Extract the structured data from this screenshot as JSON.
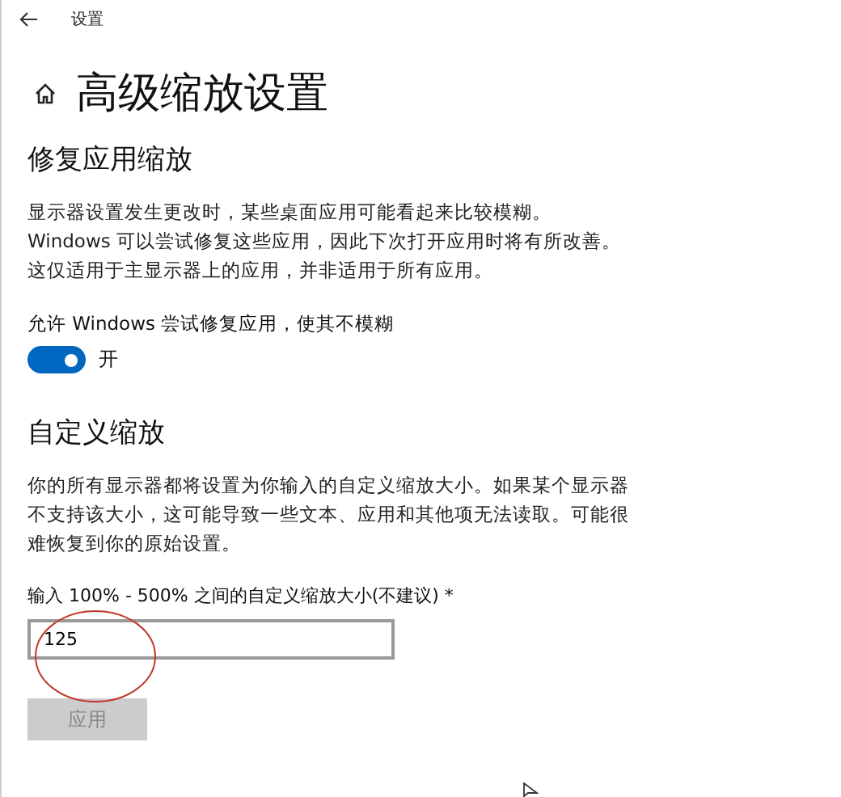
{
  "window": {
    "title": "设置"
  },
  "page": {
    "title": "高级缩放设置"
  },
  "fix_section": {
    "heading": "修复应用缩放",
    "description": "显示器设置发生更改时，某些桌面应用可能看起来比较模糊。Windows 可以尝试修复这些应用，因此下次打开应用时将有所改善。这仅适用于主显示器上的应用，并非适用于所有应用。",
    "toggle": {
      "label": "允许 Windows 尝试修复应用，使其不模糊",
      "on": true,
      "state_text": "开"
    }
  },
  "custom_section": {
    "heading": "自定义缩放",
    "description": "你的所有显示器都将设置为你输入的自定义缩放大小。如果某个显示器不支持该大小，这可能导致一些文本、应用和其他项无法读取。可能很难恢复到你的原始设置。",
    "field": {
      "label": "输入 100% - 500% 之间的自定义缩放大小(不建议) *",
      "value": "125"
    },
    "apply_button": {
      "label": "应用",
      "disabled": true
    }
  }
}
